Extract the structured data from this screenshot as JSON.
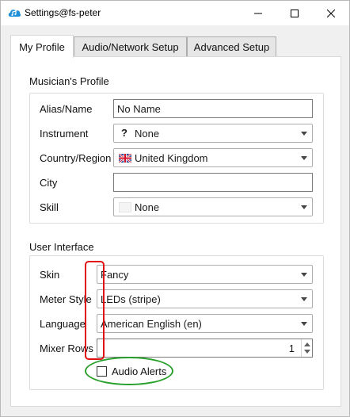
{
  "window": {
    "title": "Settings@fs-peter",
    "controls": {
      "minimize_icon": "minimize-icon",
      "maximize_icon": "maximize-icon",
      "close_icon": "close-icon"
    }
  },
  "tabs": [
    {
      "label": "My Profile",
      "active": true
    },
    {
      "label": "Audio/Network Setup",
      "active": false
    },
    {
      "label": "Advanced Setup",
      "active": false
    }
  ],
  "profile": {
    "group_title": "Musician's Profile",
    "alias_label": "Alias/Name",
    "alias_value": "No Name",
    "instrument_label": "Instrument",
    "instrument_value": "None",
    "instrument_icon": "question-mark-icon",
    "country_label": "Country/Region",
    "country_value": "United Kingdom",
    "country_icon": "uk-flag-icon",
    "city_label": "City",
    "city_value": "",
    "skill_label": "Skill",
    "skill_value": "None",
    "skill_icon": "blank-skill-icon"
  },
  "interface": {
    "group_title": "User Interface",
    "skin_label": "Skin",
    "skin_value": "Fancy",
    "meter_label": "Meter Style",
    "meter_value": "LEDs (stripe)",
    "language_label": "Language",
    "language_value": "American English (en)",
    "mixer_rows_label": "Mixer Rows",
    "mixer_rows_value": "1",
    "audio_alerts_label": "Audio Alerts",
    "audio_alerts_checked": false
  },
  "annotations": {
    "red_color": "#e01010",
    "green_color": "#28a02c"
  }
}
